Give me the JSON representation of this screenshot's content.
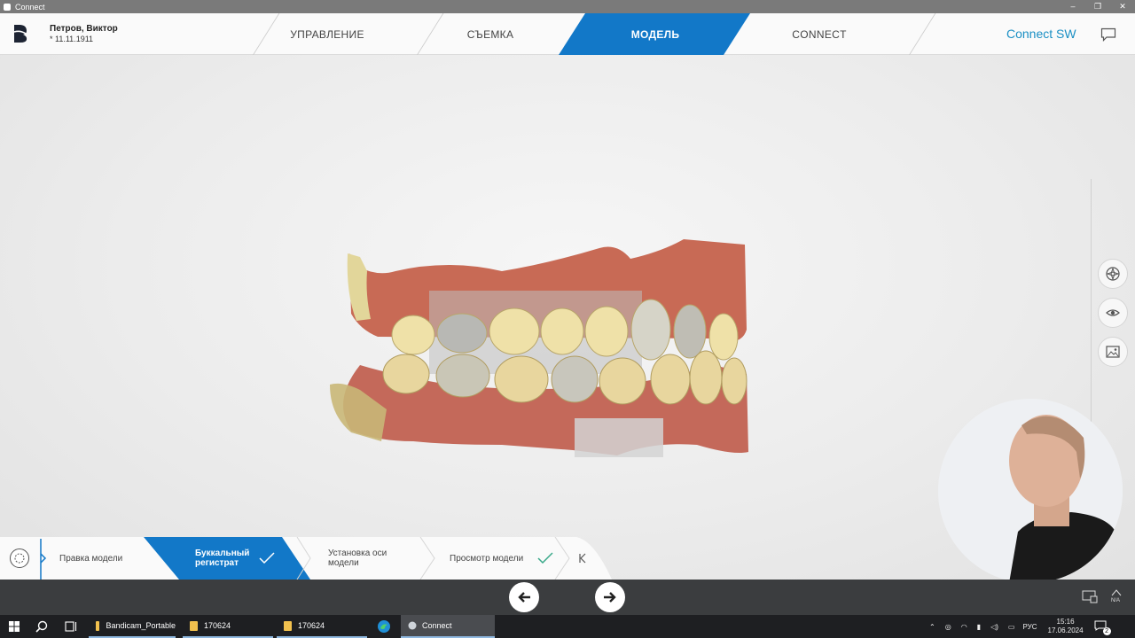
{
  "window": {
    "title": "Connect",
    "controls": [
      "–",
      "❐",
      "✕"
    ]
  },
  "header": {
    "patient_name": "Петров, Виктор",
    "patient_dob": "* 11.11.1911",
    "tabs": [
      {
        "label": "УПРАВЛЕНИЕ",
        "active": false
      },
      {
        "label": "СЪЕМКА",
        "active": false
      },
      {
        "label": "МОДЕЛЬ",
        "active": true
      },
      {
        "label": "CONNECT",
        "active": false
      }
    ],
    "connect_sw": "Connect SW"
  },
  "colors": {
    "accent": "#1278c8",
    "link": "#1a8fc4",
    "check": "#3aa98a"
  },
  "side_tools": [
    "compass-icon",
    "eye-icon",
    "image-icon"
  ],
  "steps": [
    {
      "label": "Правка модели",
      "active": false,
      "done": false
    },
    {
      "label": "Буккальный регистрат",
      "active": true,
      "done": true
    },
    {
      "label": "Установка оси модели",
      "active": false,
      "done": false
    },
    {
      "label": "Просмотр модели",
      "active": false,
      "done": true
    }
  ],
  "taskbar": {
    "apps": [
      {
        "label": "Bandicam_Portable",
        "active": false
      },
      {
        "label": "170624",
        "active": false
      },
      {
        "label": "170624",
        "active": false
      },
      {
        "label": "Connect",
        "active": true
      }
    ],
    "lang": "РУС",
    "time": "15:16",
    "date": "17.06.2024",
    "notif_count": "2",
    "na_label": "N/A"
  }
}
